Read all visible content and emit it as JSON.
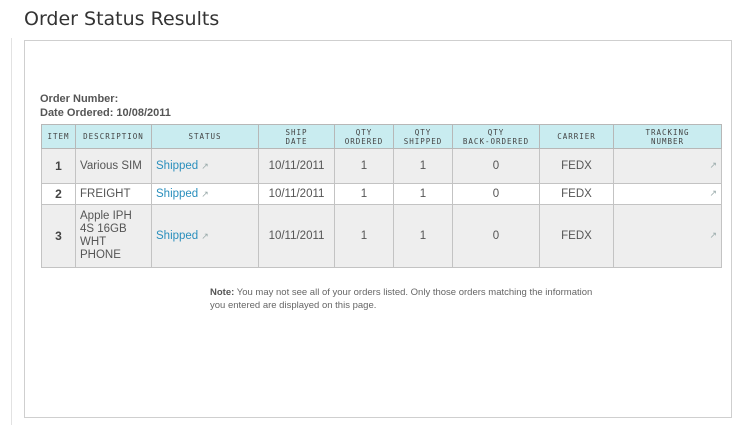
{
  "page": {
    "title": "Order Status Results"
  },
  "order": {
    "number_label": "Order Number:",
    "number_value": "",
    "date_label": "Date Ordered:",
    "date_value": "10/08/2011"
  },
  "table": {
    "headers": {
      "item": "ITEM",
      "description": "DESCRIPTION",
      "status": "STATUS",
      "ship_date_1": "SHIP",
      "ship_date_2": "DATE",
      "qty_ordered_1": "QTY",
      "qty_ordered_2": "ORDERED",
      "qty_shipped_1": "QTY",
      "qty_shipped_2": "SHIPPED",
      "qty_back_1": "QTY",
      "qty_back_2": "BACK-ORDERED",
      "carrier": "CARRIER",
      "tracking_1": "TRACKING",
      "tracking_2": "NUMBER"
    },
    "rows": [
      {
        "item": "1",
        "description": "Various SIM",
        "status": "Shipped",
        "ship_date": "10/11/2011",
        "qty_ordered": "1",
        "qty_shipped": "1",
        "qty_back": "0",
        "carrier": "FEDX",
        "tracking": ""
      },
      {
        "item": "2",
        "description": "FREIGHT",
        "status": "Shipped",
        "ship_date": "10/11/2011",
        "qty_ordered": "1",
        "qty_shipped": "1",
        "qty_back": "0",
        "carrier": "FEDX",
        "tracking": ""
      },
      {
        "item": "3",
        "description": "Apple IPH 4S 16GB WHT PHONE",
        "status": "Shipped",
        "ship_date": "10/11/2011",
        "qty_ordered": "1",
        "qty_shipped": "1",
        "qty_back": "0",
        "carrier": "FEDX",
        "tracking": ""
      }
    ]
  },
  "note": {
    "label": "Note:",
    "text": "You may not see all of your orders listed. Only those orders matching the information you entered are displayed on this page."
  },
  "icons": {
    "external_link": "external-link-icon"
  },
  "colors": {
    "header_bg": "#c9ecf0",
    "link": "#2a8fbd",
    "shade_row": "#eeeeee"
  }
}
